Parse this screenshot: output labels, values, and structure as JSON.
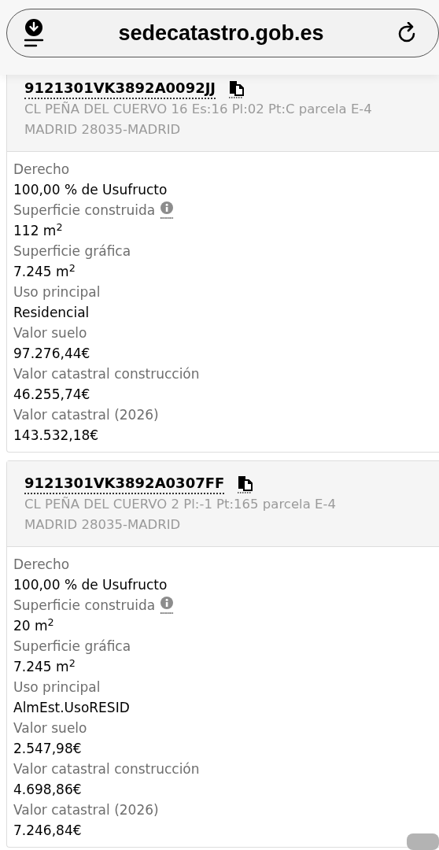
{
  "address_bar": {
    "url": "sedecatastro.gob.es"
  },
  "properties": [
    {
      "reference": "9121301VK3892A0092JJ",
      "address_lines": [
        "CL PEÑA DEL CUERVO 16 Es:16 Pl:02 Pt:C parcela E-4",
        "MADRID 28035-MADRID"
      ],
      "fields": [
        {
          "label": "Derecho",
          "value": "100,00 % de Usufructo",
          "info": false
        },
        {
          "label": "Superficie construida",
          "value": "112 m$^{2}$",
          "info": true
        },
        {
          "label": "Superficie gráfica",
          "value": "7.245 m$^{2}$",
          "info": false
        },
        {
          "label": "Uso principal",
          "value": "Residencial",
          "info": false
        },
        {
          "label": "Valor suelo",
          "value": "97.276,44€",
          "info": false
        },
        {
          "label": "Valor catastral construcción",
          "value": "46.255,74€",
          "info": false
        },
        {
          "label": "Valor catastral (2026)",
          "value": "143.532,18€",
          "info": false
        }
      ]
    },
    {
      "reference": "9121301VK3892A0307FF",
      "address_lines": [
        "CL PEÑA DEL CUERVO 2 Pl:-1 Pt:165 parcela E-4",
        "MADRID 28035-MADRID"
      ],
      "fields": [
        {
          "label": "Derecho",
          "value": "100,00 % de Usufructo",
          "info": false
        },
        {
          "label": "Superficie construida",
          "value": "20 m$^{2}$",
          "info": true
        },
        {
          "label": "Superficie gráfica",
          "value": "7.245 m$^{2}$",
          "info": false
        },
        {
          "label": "Uso principal",
          "value": "AlmEst.UsoRESID",
          "info": false
        },
        {
          "label": "Valor suelo",
          "value": "2.547,98€",
          "info": false
        },
        {
          "label": "Valor catastral construcción",
          "value": "4.698,86€",
          "info": false
        },
        {
          "label": "Valor catastral (2026)",
          "value": "7.246,84€",
          "info": false
        }
      ]
    }
  ]
}
